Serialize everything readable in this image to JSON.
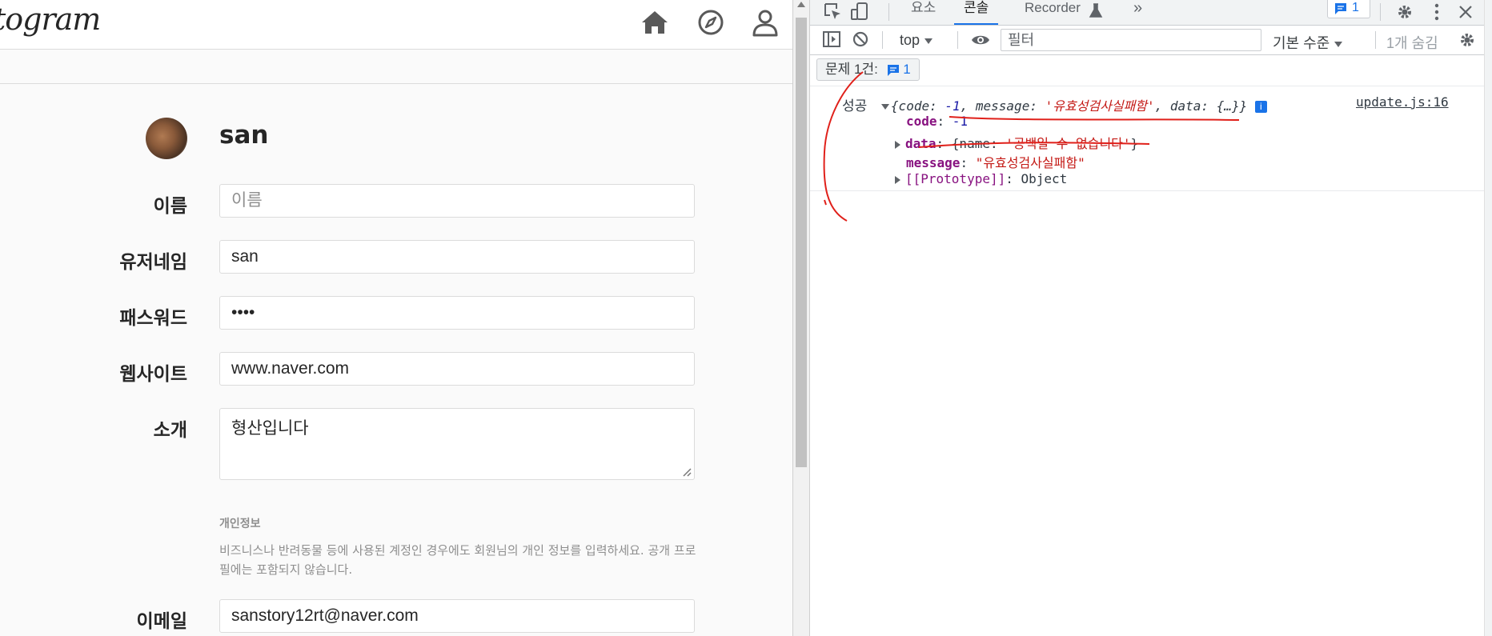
{
  "app": {
    "logo": "togram",
    "profile": {
      "username": "san"
    },
    "form": {
      "name": {
        "label": "이름",
        "value": "",
        "placeholder": "이름"
      },
      "username": {
        "label": "유저네임",
        "value": "san"
      },
      "password": {
        "label": "패스워드",
        "value": "••••"
      },
      "website": {
        "label": "웹사이트",
        "value": "www.naver.com"
      },
      "bio": {
        "label": "소개",
        "value": "형산입니다"
      },
      "privacy_title": "개인정보",
      "privacy_desc": "비즈니스나 반려동물 등에 사용된 계정인 경우에도 회원님의 개인 정보를 입력하세요. 공개 프로필에는 포함되지 않습니다.",
      "email": {
        "label": "이메일",
        "value": "sanstory12rt@naver.com"
      }
    },
    "header_icons": [
      "home-icon",
      "compass-icon",
      "user-icon"
    ]
  },
  "devtools": {
    "tabs": [
      {
        "label": "요소",
        "active": false
      },
      {
        "label": "콘솔",
        "active": true
      },
      {
        "label": "Recorder",
        "active": false
      }
    ],
    "more_tabs": "»",
    "issues_badge": "1",
    "toolbar": {
      "context": "top",
      "filter_placeholder": "필터",
      "levels": "기본 수준",
      "hidden_count": "1개 숨김"
    },
    "issues_label": "문제 1건:",
    "issues_count": "1",
    "console": {
      "log_label": "성공",
      "summary_prefix": "{code: ",
      "summary_code": "-1",
      "summary_mid1": ", message: ",
      "summary_message": "'유효성검사실패함'",
      "summary_mid2": ", data: {…}}",
      "info_glyph": "i",
      "source": "update.js:16",
      "code_key": "code",
      "code_val": "-1",
      "data_key": "data",
      "data_prefix": "{name: ",
      "data_val": "'공백일 수 없습니다'",
      "data_suffix": "}",
      "message_key": "message",
      "message_val": "\"유효성검사실패함\"",
      "proto_key": "[[Prototype]]",
      "proto_val": "Object"
    }
  },
  "colors": {
    "accent_blue": "#1a73e8",
    "string_red": "#c41a16",
    "key_purple": "#881280",
    "number_blue": "#1a1aa6",
    "annotation_red": "#e0201a"
  }
}
